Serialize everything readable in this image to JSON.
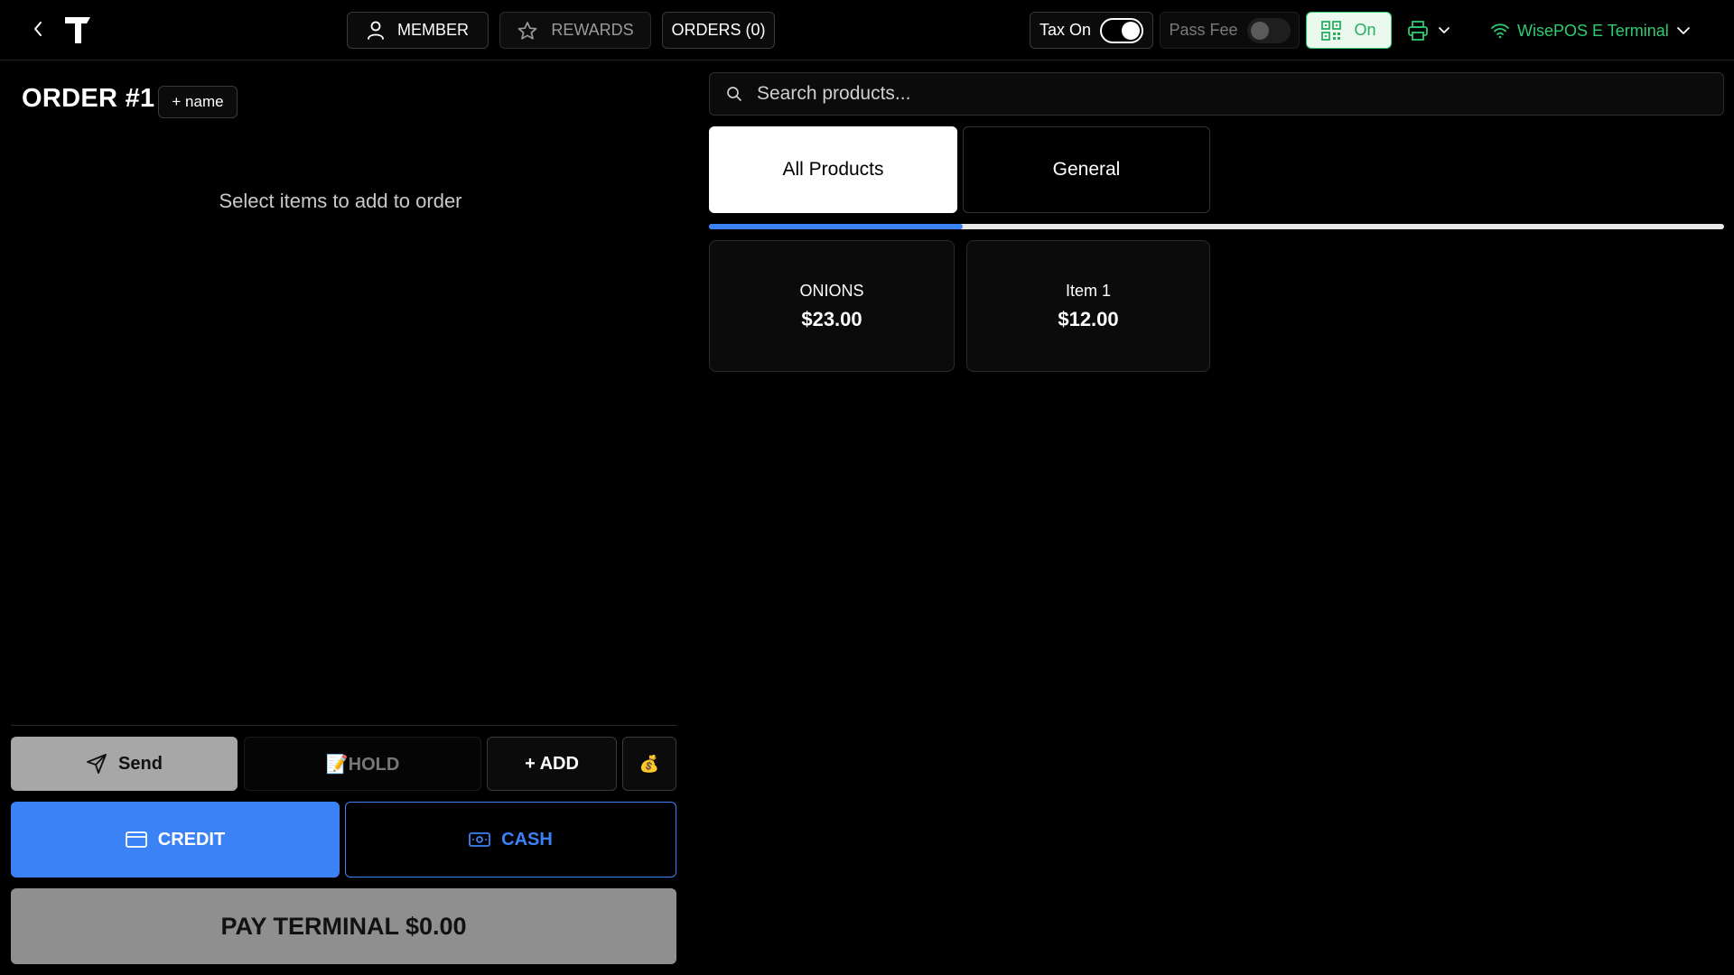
{
  "header": {
    "member_label": "MEMBER",
    "rewards_label": "REWARDS",
    "orders_label": "ORDERS (0)",
    "tax_label": "Tax On",
    "tax_enabled": true,
    "pass_fee_label": "Pass Fee",
    "pass_fee_enabled": false,
    "qr_label": "On",
    "terminal_label": "WisePOS E Terminal"
  },
  "order": {
    "title": "ORDER #1",
    "name_button": "+ name",
    "empty_message": "Select items to add to order"
  },
  "actions": {
    "send": "Send",
    "hold": "📝HOLD",
    "add": "+ ADD",
    "bag_icon": "💰",
    "credit": "CREDIT",
    "cash": "CASH",
    "pay_terminal": "PAY TERMINAL $0.00"
  },
  "search": {
    "placeholder": "Search products..."
  },
  "categories": [
    {
      "label": "All Products",
      "active": true
    },
    {
      "label": "General",
      "active": false
    }
  ],
  "category_scroll_fraction": 0.25,
  "products": [
    {
      "name": "ONIONS",
      "price": "$23.00"
    },
    {
      "name": "Item 1",
      "price": "$12.00"
    }
  ],
  "colors": {
    "accent_blue": "#3b82f6",
    "success_green": "#2ecc71",
    "background": "#000000"
  },
  "icons": {
    "back": "chevron-left-icon",
    "logo": "brand-logo",
    "member": "user-icon",
    "rewards": "star-icon",
    "qr": "qr-code-icon",
    "printer": "printer-icon",
    "wifi": "wifi-icon",
    "search": "search-icon",
    "send": "send-icon",
    "credit": "credit-card-icon",
    "cash": "cash-icon"
  }
}
